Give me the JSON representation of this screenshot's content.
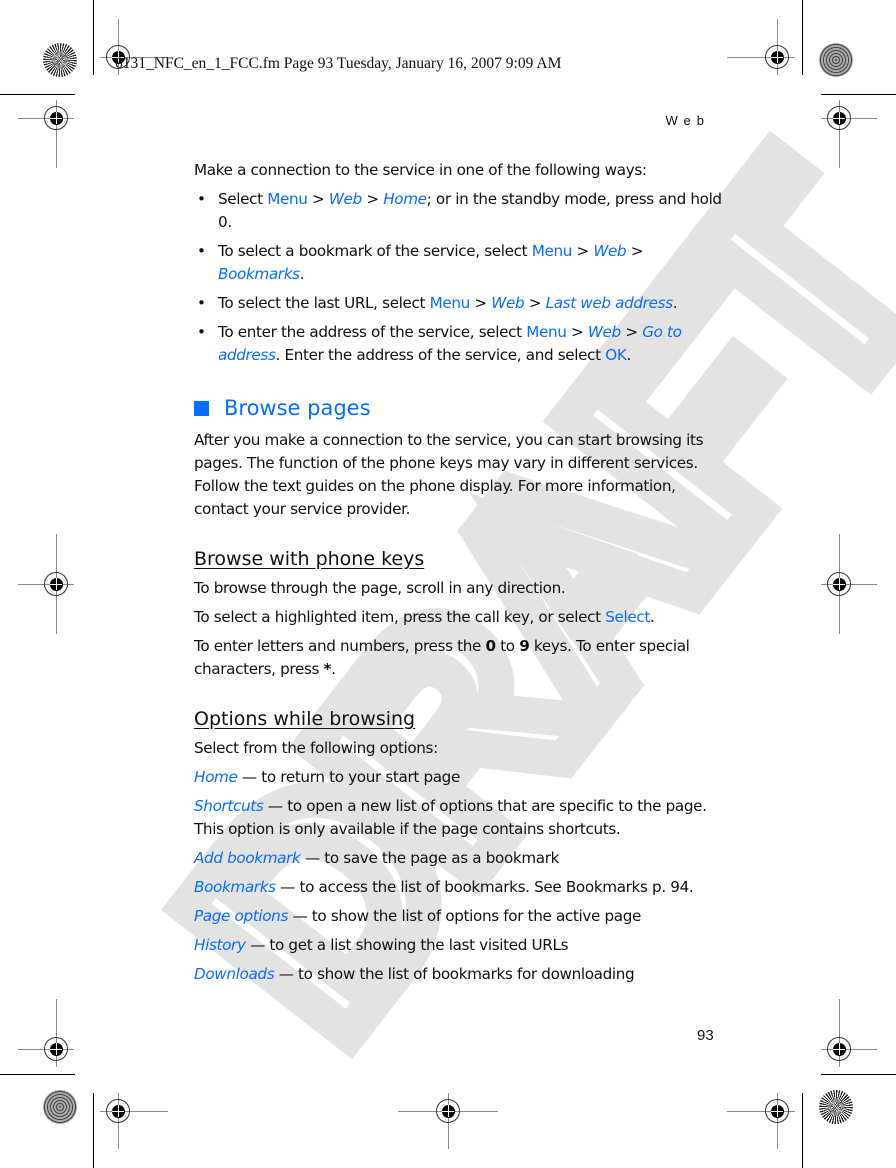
{
  "print_slug": "6131_NFC_en_1_FCC.fm  Page 93  Tuesday, January 16, 2007  9:09 AM",
  "running_head": "Web",
  "page_number": "93",
  "watermark": "DRAFT",
  "accent_color": "#0a6cff",
  "intro": "Make a connection to the service in one of the following ways:",
  "bullets": [
    {
      "t1": "Select ",
      "menu": "Menu",
      "sep1": " > ",
      "web": "Web",
      "sep2": " > ",
      "target": "Home",
      "rest": "; or in the standby mode, press and hold 0."
    },
    {
      "t1": "To select a bookmark of the service, select ",
      "menu": "Menu",
      "sep1": " > ",
      "web": "Web",
      "sep2": " > ",
      "target": "Bookmarks",
      "rest": "."
    },
    {
      "t1": "To select the last URL, select ",
      "menu": "Menu",
      "sep1": " > ",
      "web": "Web",
      "sep2": " > ",
      "target": "Last web address",
      "rest": "."
    },
    {
      "t1": "To enter the address of the service, select ",
      "menu": "Menu",
      "sep1": " > ",
      "web": "Web",
      "sep2": " > ",
      "target": "Go to address",
      "rest": ". Enter the address of the service, and select ",
      "ok": "OK",
      "end": "."
    }
  ],
  "section": {
    "title": "Browse pages",
    "body": "After you make a connection to the service, you can start browsing its pages. The function of the phone keys may vary in different services. Follow the text guides on the phone display. For more information, contact your service provider."
  },
  "browse_keys": {
    "title": "Browse with phone keys",
    "p1": "To browse through the page, scroll in any direction.",
    "p2_a": "To select a highlighted item, press the call key, or select ",
    "p2_link": "Select",
    "p2_b": ".",
    "p3_a": "To enter letters and numbers, press the ",
    "p3_k0": "0",
    "p3_mid": " to ",
    "p3_k9": "9",
    "p3_b": " keys. To enter special characters, press ",
    "p3_star": "*",
    "p3_c": "."
  },
  "options": {
    "title": "Options while browsing",
    "intro": "Select from the following options:",
    "items": [
      {
        "name": "Home",
        "desc": " — to return to your start page"
      },
      {
        "name": "Shortcuts",
        "desc": " — to open a new list of options that are specific to the page. This option is only available if the page contains shortcuts."
      },
      {
        "name": "Add bookmark",
        "desc": " — to save the page as a bookmark"
      },
      {
        "name": "Bookmarks",
        "desc": " — to access the list of bookmarks. See Bookmarks p. 94."
      },
      {
        "name": "Page options",
        "desc": " — to show the list of options for the active page"
      },
      {
        "name": "History",
        "desc": " — to get a list showing the last visited URLs"
      },
      {
        "name": "Downloads",
        "desc": " — to show the list of bookmarks for downloading"
      }
    ]
  }
}
